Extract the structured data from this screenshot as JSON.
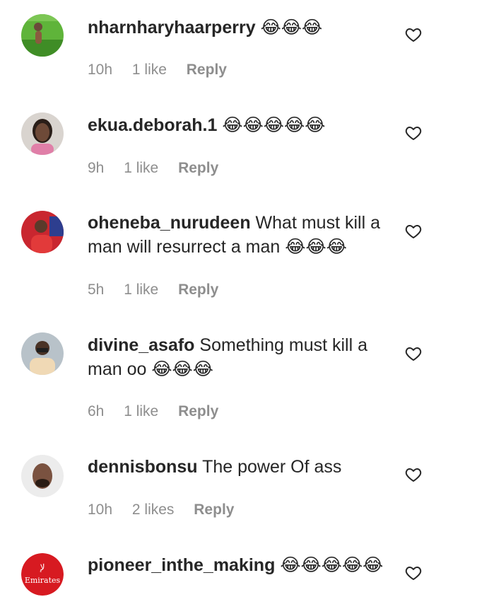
{
  "colors": {
    "text": "#262626",
    "meta": "#8e8e8e",
    "background": "#ffffff"
  },
  "comments": [
    {
      "username": "nharnharyhaarperry",
      "text": "",
      "emoji": "😂😂😂",
      "time": "10h",
      "likes": "1 like",
      "reply": "Reply"
    },
    {
      "username": "ekua.deborah.1",
      "text": "",
      "emoji": "😂😂😂😂😂",
      "time": "9h",
      "likes": "1 like",
      "reply": "Reply"
    },
    {
      "username": "oheneba_nurudeen",
      "text": "What must kill a man will resurrect a man",
      "emoji": "😂😂😂",
      "time": "5h",
      "likes": "1 like",
      "reply": "Reply"
    },
    {
      "username": "divine_asafo",
      "text": "Something must kill a man oo",
      "emoji": "😂😂😂",
      "time": "6h",
      "likes": "1 like",
      "reply": "Reply"
    },
    {
      "username": "dennisbonsu",
      "text": "The power Of ass",
      "emoji": "",
      "time": "10h",
      "likes": "2 likes",
      "reply": "Reply"
    },
    {
      "username": "pioneer_inthe_making",
      "text": "",
      "emoji": "😂😂😂😂😂",
      "time": "",
      "likes": "",
      "reply": "",
      "avatar_logo_text": "Emirates"
    }
  ],
  "icons": {
    "like": "heart-outline-icon"
  }
}
